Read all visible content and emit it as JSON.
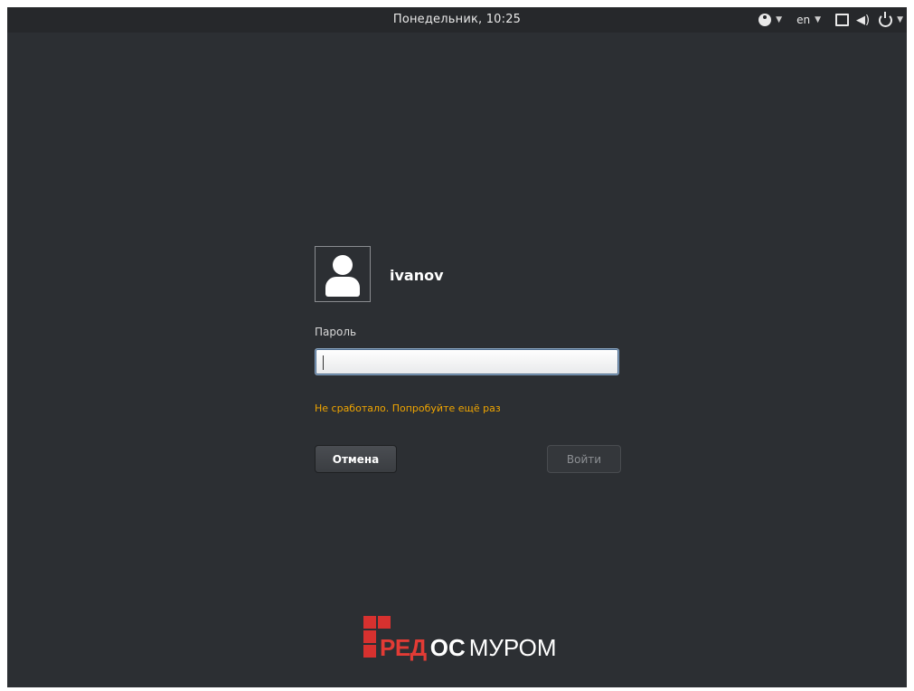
{
  "topbar": {
    "clock": "Понедельник, 10:25",
    "language": "en",
    "icons": [
      "accessibility-icon",
      "screen-icon",
      "volume-icon",
      "power-icon"
    ]
  },
  "login": {
    "username": "ivanov",
    "password_label": "Пароль",
    "password_value": "",
    "error_message": "Не сработало. Попробуйте ещё раз",
    "cancel_label": "Отмена",
    "login_label": "Войти"
  },
  "logo": {
    "red_text": "РЕД",
    "os_text": "ОС",
    "city_text": "МУРОМ"
  },
  "colors": {
    "background": "#2c2f33",
    "error": "#f0a500",
    "brand_red": "#d7312f"
  }
}
